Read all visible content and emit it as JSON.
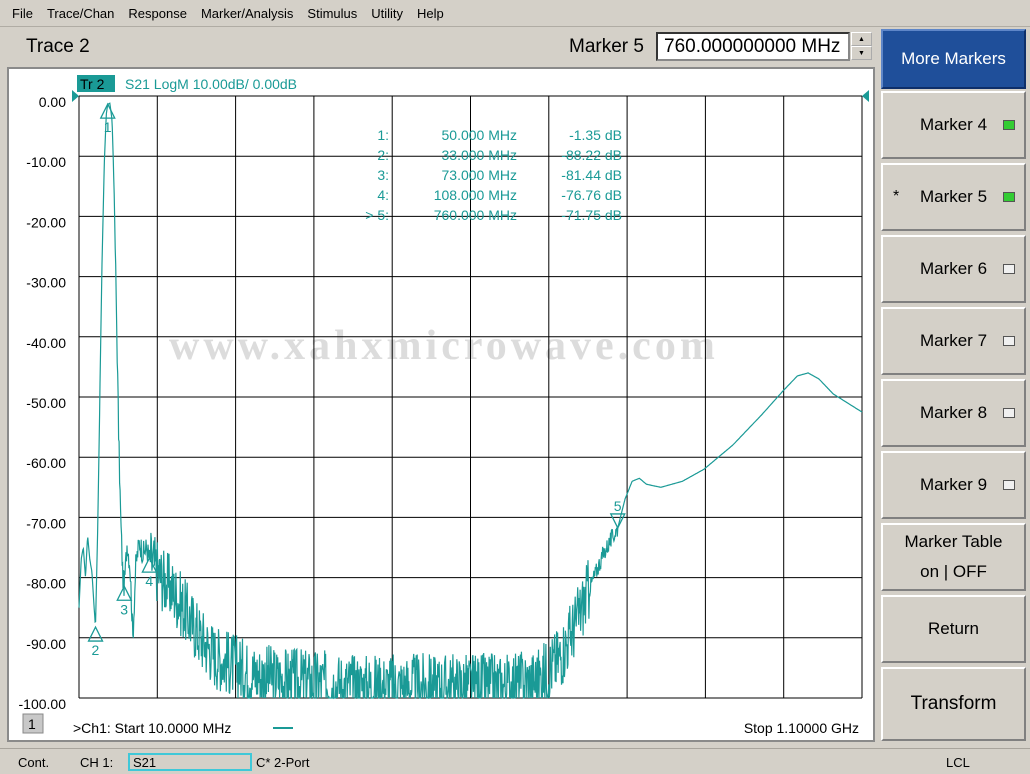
{
  "menu": [
    "File",
    "Trace/Chan",
    "Response",
    "Marker/Analysis",
    "Stimulus",
    "Utility",
    "Help"
  ],
  "header": {
    "trace_title": "Trace 2",
    "marker_label": "Marker 5",
    "marker_value": "760.000000000 MHz"
  },
  "trace_header": {
    "tag": "Tr 2",
    "text": "S21 LogM 10.00dB/  0.00dB"
  },
  "markers_table": [
    {
      "id": "1:",
      "freq": "50.000 MHz",
      "value": "-1.35 dB"
    },
    {
      "id": "2:",
      "freq": "33.000 MHz",
      "value": "-88.22 dB"
    },
    {
      "id": "3:",
      "freq": "73.000 MHz",
      "value": "-81.44 dB"
    },
    {
      "id": "4:",
      "freq": "108.000 MHz",
      "value": "-76.76 dB"
    },
    {
      "id": "> 5:",
      "freq": "760.000 MHz",
      "value": "-71.75 dB"
    }
  ],
  "footer": {
    "channel_index": "1",
    "start": ">Ch1: Start  10.0000 MHz",
    "stop": "Stop  1.10000 GHz"
  },
  "watermark": "www.xahxmicrowave.com",
  "softkeys": [
    {
      "label": "More Markers",
      "active": true
    },
    {
      "label": "Marker 4",
      "led": "on"
    },
    {
      "label": "Marker 5",
      "led": "on",
      "star": "*"
    },
    {
      "label": "Marker 6",
      "led": "off"
    },
    {
      "label": "Marker 7",
      "led": "off"
    },
    {
      "label": "Marker 8",
      "led": "off"
    },
    {
      "label": "Marker 9",
      "led": "off"
    },
    {
      "label_line1": "Marker Table",
      "label_line2": "on | OFF"
    },
    {
      "label": "Return"
    },
    {
      "label": "Transform"
    }
  ],
  "status": {
    "mode": "Cont.",
    "channel": "CH 1:",
    "param": "S21",
    "cal": "C* 2-Port",
    "lcl": "LCL"
  },
  "colors": {
    "trace": "#1a9a96",
    "grid": "#000000",
    "softkey_active": "#1f4f9a"
  },
  "chart_data": {
    "type": "line",
    "title": "S21 LogM 10.00dB/  0.00dB",
    "xlabel": "",
    "ylabel": "",
    "xlim_mhz": [
      10,
      1100
    ],
    "ylim_db": [
      -100,
      0
    ],
    "y_ticks": [
      "0.00",
      "-10.00",
      "-20.00",
      "-30.00",
      "-40.00",
      "-50.00",
      "-60.00",
      "-70.00",
      "-80.00",
      "-90.00",
      "-100.00"
    ],
    "grid": true,
    "series": [
      {
        "points_mhz_db": [
          [
            10,
            -85
          ],
          [
            13,
            -77
          ],
          [
            16,
            -75
          ],
          [
            19,
            -80
          ],
          [
            22,
            -73
          ],
          [
            25,
            -77
          ],
          [
            28,
            -79
          ],
          [
            31,
            -85
          ],
          [
            33,
            -88.2
          ],
          [
            36,
            -72
          ],
          [
            39,
            -50
          ],
          [
            42,
            -28
          ],
          [
            45,
            -12
          ],
          [
            48,
            -3
          ],
          [
            50,
            -1.35
          ],
          [
            53,
            -1.2
          ],
          [
            56,
            -4
          ],
          [
            59,
            -16
          ],
          [
            62,
            -35
          ],
          [
            65,
            -55
          ],
          [
            68,
            -70
          ],
          [
            71,
            -80
          ],
          [
            73,
            -81.4
          ],
          [
            77,
            -74
          ],
          [
            81,
            -78
          ],
          [
            85,
            -90
          ],
          [
            89,
            -78
          ],
          [
            94,
            -74
          ],
          [
            99,
            -76
          ],
          [
            104,
            -75
          ],
          [
            108,
            -76.8
          ],
          [
            115,
            -78
          ],
          [
            125,
            -80
          ],
          [
            140,
            -82
          ],
          [
            160,
            -86
          ],
          [
            180,
            -90
          ],
          [
            200,
            -93
          ],
          [
            250,
            -96
          ],
          [
            300,
            -97
          ],
          [
            400,
            -98
          ],
          [
            500,
            -98
          ],
          [
            600,
            -98
          ],
          [
            650,
            -97
          ],
          [
            680,
            -93
          ],
          [
            700,
            -88
          ],
          [
            720,
            -82
          ],
          [
            740,
            -76
          ],
          [
            760,
            -71.75
          ],
          [
            770,
            -67
          ],
          [
            780,
            -64
          ],
          [
            790,
            -63.5
          ],
          [
            800,
            -64.5
          ],
          [
            820,
            -65
          ],
          [
            850,
            -64
          ],
          [
            880,
            -62
          ],
          [
            920,
            -58
          ],
          [
            960,
            -53
          ],
          [
            990,
            -49
          ],
          [
            1010,
            -46.5
          ],
          [
            1025,
            -46
          ],
          [
            1040,
            -47
          ],
          [
            1060,
            -49.5
          ],
          [
            1080,
            -51
          ],
          [
            1100,
            -52.5
          ]
        ]
      }
    ],
    "markers": [
      {
        "label": "1",
        "x_mhz": 50,
        "y_db": -1.35
      },
      {
        "label": "2",
        "x_mhz": 33,
        "y_db": -88.22
      },
      {
        "label": "3",
        "x_mhz": 73,
        "y_db": -81.44
      },
      {
        "label": "4",
        "x_mhz": 108,
        "y_db": -76.76
      },
      {
        "label": "5",
        "x_mhz": 760,
        "y_db": -71.75
      }
    ]
  }
}
